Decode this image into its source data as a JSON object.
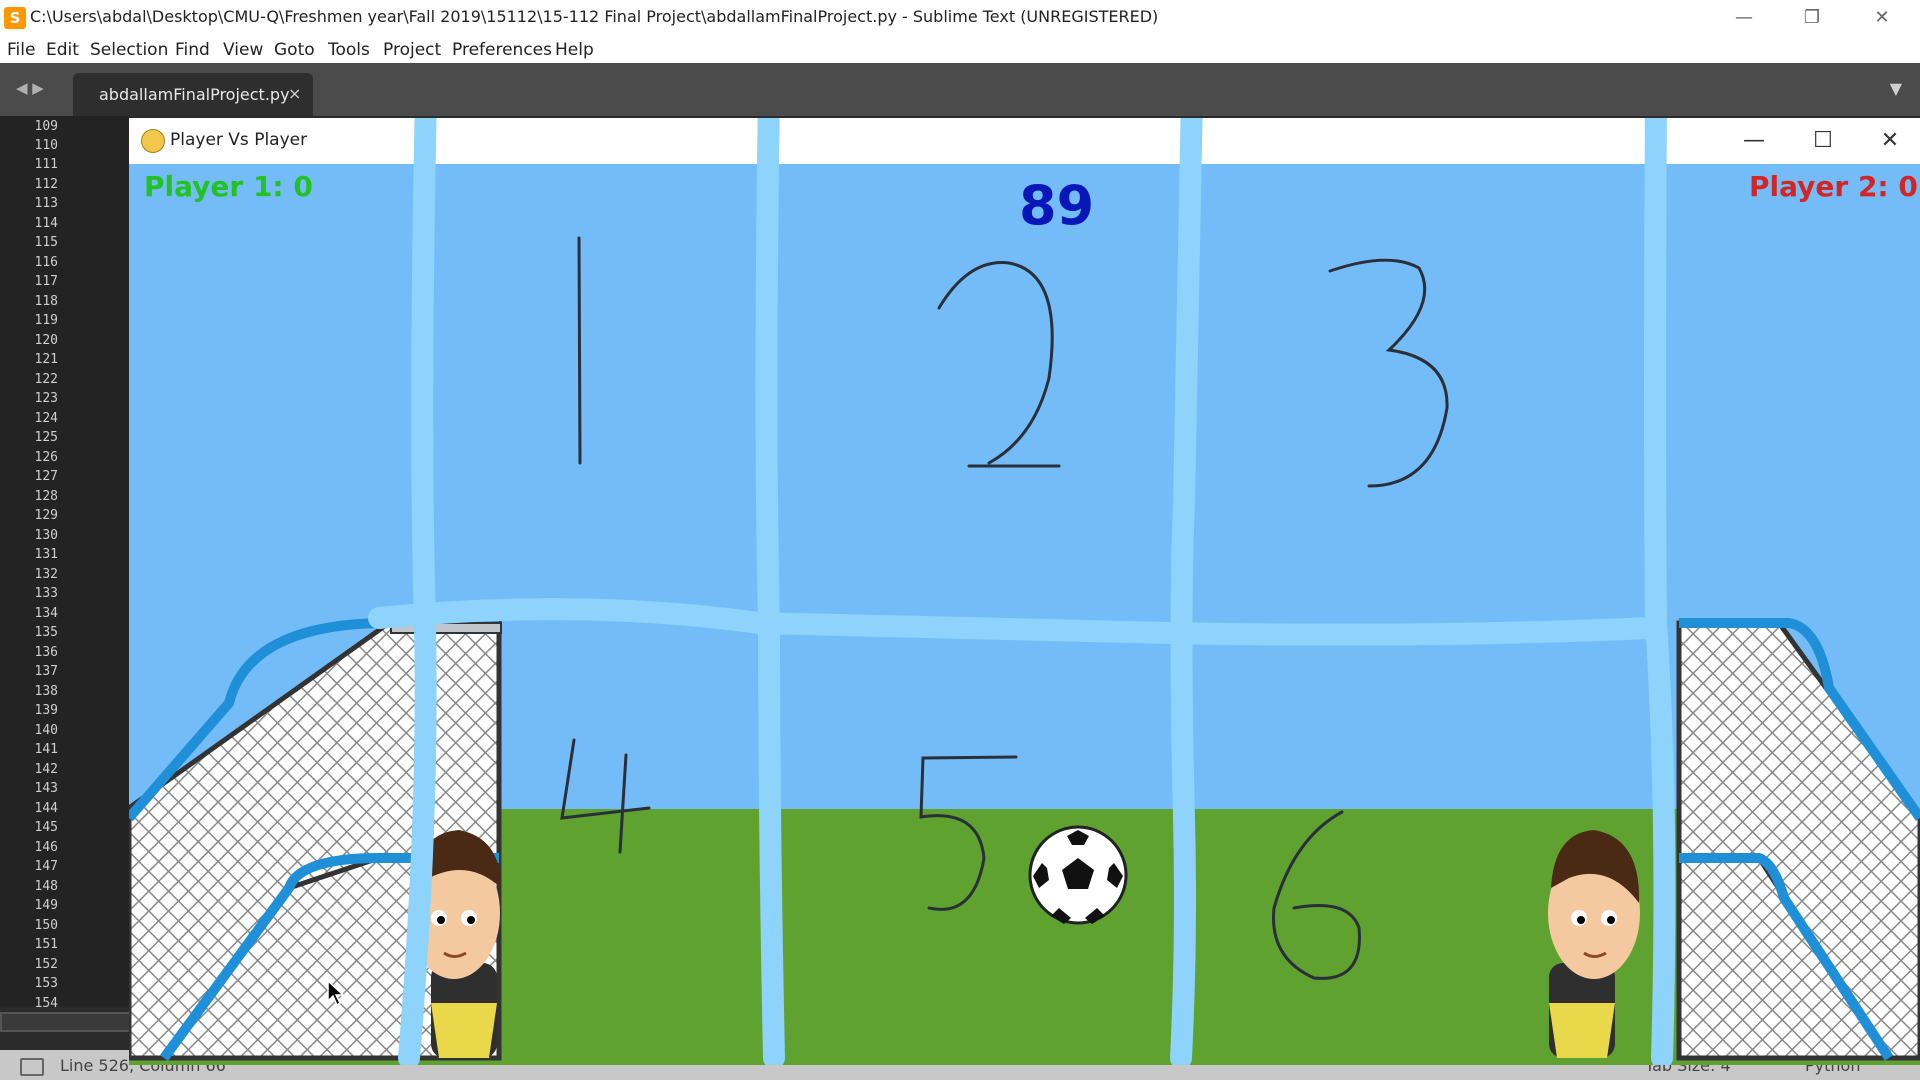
{
  "sublime": {
    "title": "C:\\Users\\abdal\\Desktop\\CMU-Q\\Freshmen year\\Fall 2019\\15112\\15-112 Final Project\\abdallamFinalProject.py - Sublime Text (UNREGISTERED)",
    "menu": [
      "File",
      "Edit",
      "Selection",
      "Find",
      "View",
      "Goto",
      "Tools",
      "Project",
      "Preferences",
      "Help"
    ],
    "tab": {
      "label": "abdallamFinalProject.py",
      "close": "×"
    },
    "line_numbers": [
      "109",
      "110",
      "111",
      "112",
      "113",
      "114",
      "115",
      "116",
      "117",
      "118",
      "119",
      "120",
      "121",
      "122",
      "123",
      "124",
      "125",
      "126",
      "127",
      "128",
      "129",
      "130",
      "131",
      "132",
      "133",
      "134",
      "135",
      "136",
      "137",
      "138",
      "139",
      "140",
      "141",
      "142",
      "143",
      "144",
      "145",
      "146",
      "147",
      "148",
      "149",
      "150",
      "151",
      "152",
      "153",
      "154"
    ],
    "status": {
      "position": "Line 526, Column 66",
      "tab_size": "Tab Size: 4",
      "syntax": "Python"
    }
  },
  "game": {
    "window_title": "Player Vs Player",
    "player1_score": "Player 1: 0",
    "player2_score": "Player 2: 0",
    "timer": "89",
    "zone_labels": [
      "1",
      "2",
      "3",
      "4",
      "5",
      "6"
    ]
  },
  "colors": {
    "sky": "#73bcf7",
    "grass": "#5fa22f",
    "grid_lines": "#8dd3fb",
    "player1_text": "#23c223",
    "player2_text": "#d42525",
    "timer_text": "#0a17b8"
  },
  "icons": [
    "sublime-logo-icon",
    "pygame-icon",
    "minimize-icon",
    "maximize-icon",
    "close-icon",
    "soccer-ball-icon",
    "goal-net-icon",
    "player-head-icon",
    "cursor-icon"
  ]
}
